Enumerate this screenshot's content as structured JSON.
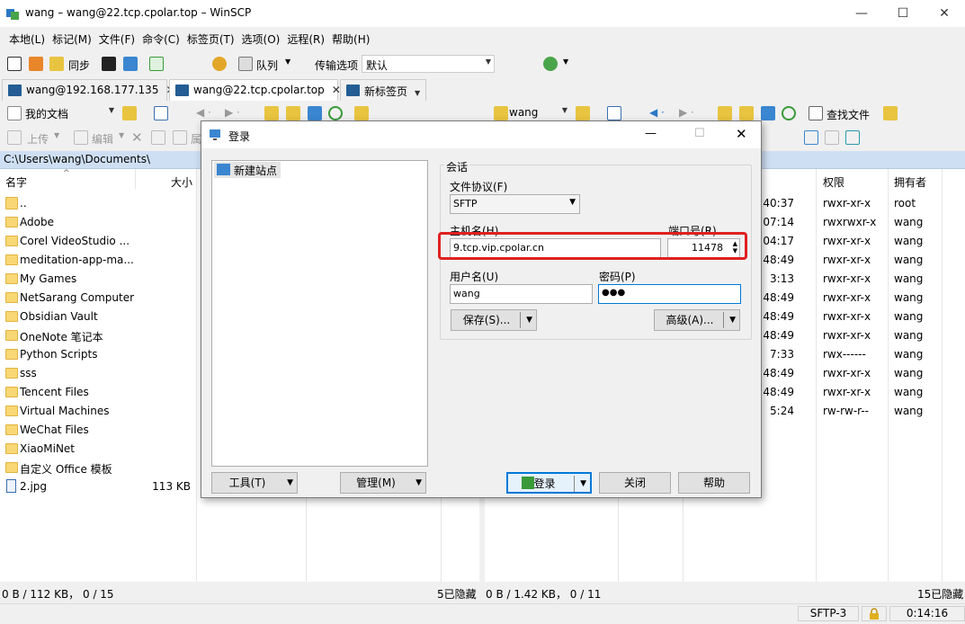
{
  "window": {
    "title": "wang – wang@22.tcp.cpolar.top – WinSCP"
  },
  "menu": [
    "本地(L)",
    "标记(M)",
    "文件(F)",
    "命令(C)",
    "标签页(T)",
    "选项(O)",
    "远程(R)",
    "帮助(H)"
  ],
  "toolbar1": {
    "sync_label": "同步",
    "queue_label": "队列",
    "transfer_label": "传输选项",
    "transfer_value": "默认"
  },
  "tabs": [
    {
      "label": "wang@192.168.177.135"
    },
    {
      "label": "wang@22.tcp.cpolar.top"
    },
    {
      "label": "新标签页"
    }
  ],
  "toolbar2": {
    "left_location": "我的文档",
    "right_location": "wang",
    "find_files_label": "查找文件"
  },
  "toolbar3": {
    "upload_label": "上传",
    "edit_label": "编辑",
    "props_fragment": "属"
  },
  "left_panel": {
    "path": "C:\\Users\\wang\\Documents\\",
    "headers": {
      "name": "名字",
      "size": "大小"
    },
    "rows": [
      {
        "name": "..",
        "size": "",
        "icon": "parent-dir-icon"
      },
      {
        "name": "Adobe",
        "size": "",
        "icon": "folder-icon"
      },
      {
        "name": "Corel VideoStudio ...",
        "size": "",
        "icon": "folder-icon"
      },
      {
        "name": "meditation-app-ma...",
        "size": "",
        "icon": "folder-icon"
      },
      {
        "name": "My Games",
        "size": "",
        "icon": "folder-icon"
      },
      {
        "name": "NetSarang Computer",
        "size": "",
        "icon": "folder-icon"
      },
      {
        "name": "Obsidian Vault",
        "size": "",
        "icon": "folder-icon"
      },
      {
        "name": "OneNote 笔记本",
        "size": "",
        "icon": "folder-icon"
      },
      {
        "name": "Python Scripts",
        "size": "",
        "icon": "folder-icon"
      },
      {
        "name": "sss",
        "size": "",
        "icon": "folder-icon"
      },
      {
        "name": "Tencent Files",
        "size": "",
        "icon": "folder-icon"
      },
      {
        "name": "Virtual Machines",
        "size": "",
        "icon": "folder-icon"
      },
      {
        "name": "WeChat Files",
        "size": "",
        "icon": "folder-icon"
      },
      {
        "name": "XiaoMiNet",
        "size": "",
        "icon": "folder-icon"
      },
      {
        "name": "自定义 Office 模板",
        "size": "",
        "icon": "folder-icon"
      },
      {
        "name": "2.jpg",
        "size": "113 KB",
        "icon": "image-file-icon"
      }
    ],
    "status_left": "0 B / 112 KB， 0 / 15",
    "status_right": "5已隐藏"
  },
  "right_panel": {
    "headers": {
      "perm": "权限",
      "owner": "拥有者"
    },
    "rows": [
      {
        "time": "4:40:37",
        "perm": "rwxr-xr-x",
        "owner": "root"
      },
      {
        "time": "07:14",
        "perm": "rwxrwxr-x",
        "owner": "wang"
      },
      {
        "time": "04:17",
        "perm": "rwxr-xr-x",
        "owner": "wang"
      },
      {
        "time": "8:48:49",
        "perm": "rwxr-xr-x",
        "owner": "wang"
      },
      {
        "time": "3:13",
        "perm": "rwxr-xr-x",
        "owner": "wang"
      },
      {
        "time": "8:48:49",
        "perm": "rwxr-xr-x",
        "owner": "wang"
      },
      {
        "time": "8:48:49",
        "perm": "rwxr-xr-x",
        "owner": "wang"
      },
      {
        "time": "8:48:49",
        "perm": "rwxr-xr-x",
        "owner": "wang"
      },
      {
        "time": "7:33",
        "perm": "rwx------",
        "owner": "wang"
      },
      {
        "time": "8:48:49",
        "perm": "rwxr-xr-x",
        "owner": "wang"
      },
      {
        "time": "8:48:49",
        "perm": "rwxr-xr-x",
        "owner": "wang"
      },
      {
        "time": "5:24",
        "perm": "rw-rw-r--",
        "owner": "wang"
      }
    ],
    "status_left": "0 B / 1.42 KB， 0 / 11",
    "status_right": "15已隐藏"
  },
  "statusbar": {
    "protocol": "SFTP-3",
    "elapsed": "0:14:16"
  },
  "login": {
    "title": "登录",
    "site_item": "新建站点",
    "group_label": "会话",
    "protocol_label": "文件协议(F)",
    "protocol_value": "SFTP",
    "host_label": "主机名(H)",
    "host_value": "9.tcp.vip.cpolar.cn",
    "port_label": "端口号(R)",
    "port_value": "11478",
    "user_label": "用户名(U)",
    "user_value": "wang",
    "pass_label": "密码(P)",
    "pass_value": "●●●",
    "save_label": "保存(S)...",
    "advanced_label": "高级(A)...",
    "tools_label": "工具(T)",
    "manage_label": "管理(M)",
    "login_label": "登录",
    "close_label": "关闭",
    "help_label": "帮助"
  },
  "colors": {
    "accent": "#0078d7",
    "highlight": "#e02020",
    "pathbar": "#cfdff3"
  }
}
